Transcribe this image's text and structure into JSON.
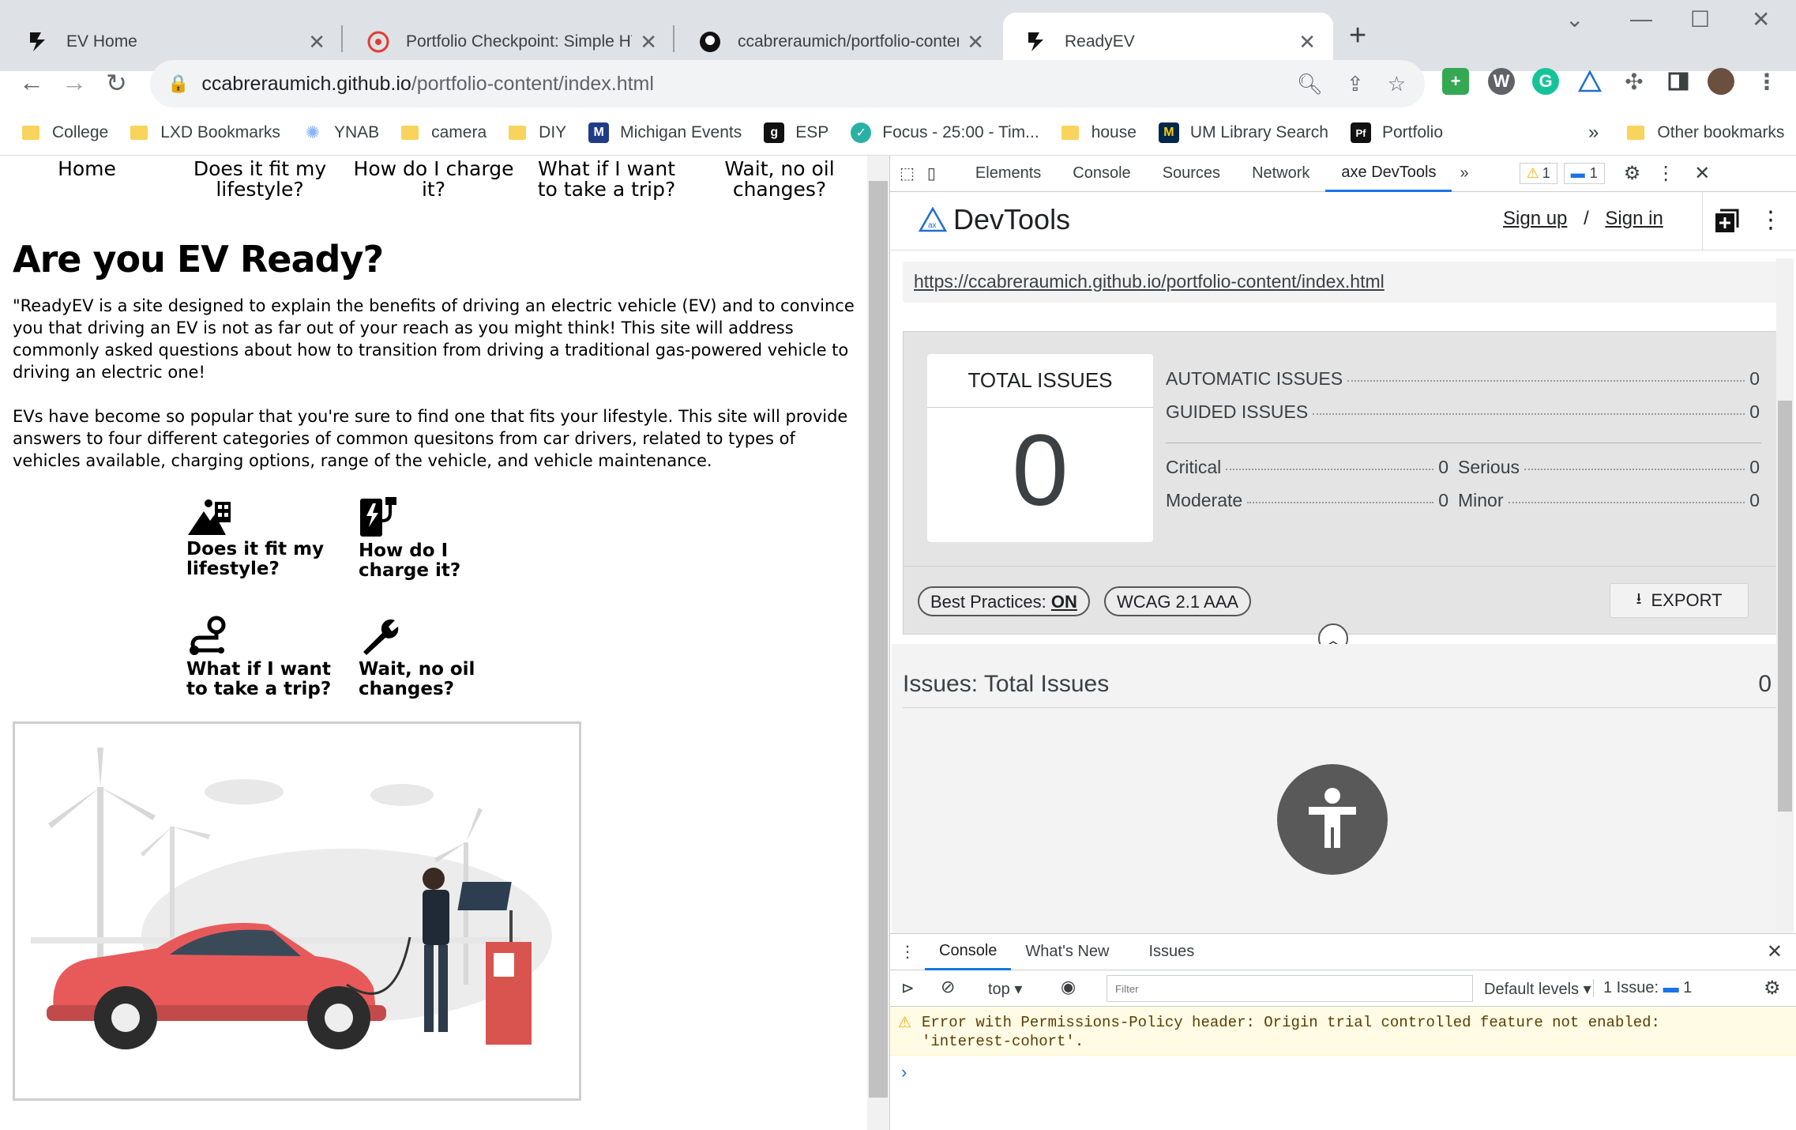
{
  "tabs": [
    {
      "title": "EV Home",
      "icon": "bolt-icon"
    },
    {
      "title": "Portfolio Checkpoint: Simple HTML",
      "icon": "canvas-icon"
    },
    {
      "title": "ccabreraumich/portfolio-content",
      "icon": "github-icon"
    },
    {
      "title": "ReadyEV",
      "icon": "bolt-icon",
      "active": true
    }
  ],
  "address": {
    "host": "ccabreraumich.github.io",
    "path": "/portfolio-content/index.html"
  },
  "bookmarks": [
    {
      "label": "College",
      "icon": "folder"
    },
    {
      "label": "LXD Bookmarks",
      "icon": "folder"
    },
    {
      "label": "YNAB",
      "icon": "ynab-icon"
    },
    {
      "label": "camera",
      "icon": "folder"
    },
    {
      "label": "DIY",
      "icon": "folder"
    },
    {
      "label": "Michigan Events",
      "icon": "events-icon"
    },
    {
      "label": "ESP",
      "icon": "esp-icon"
    },
    {
      "label": "Focus - 25:00 - Tim...",
      "icon": "check-icon"
    },
    {
      "label": "house",
      "icon": "folder"
    },
    {
      "label": "UM Library Search",
      "icon": "um-icon"
    },
    {
      "label": "Portfolio",
      "icon": "portfolio-icon"
    }
  ],
  "bookmarks_more": "»",
  "other_bookmarks": "Other bookmarks",
  "site": {
    "nav": [
      "Home",
      "Does it fit my lifestyle?",
      "How do I charge it?",
      "What if I want to take a trip?",
      "Wait, no oil changes?"
    ],
    "heading": "Are you EV Ready?",
    "p1": "\"ReadyEV is a site designed to explain the benefits of driving an electric vehicle (EV) and to convince you that driving an EV is not as far out of your reach as you might think! This site will address commonly asked questions about how to transition from driving a traditional gas-powered vehicle to driving an electric one!",
    "p2": "EVs have become so popular that you're sure to find one that fits your lifestyle. This site will provide answers to four different categories of common quesitons from car drivers, related to types of vehicles available, charging options, range of the vehicle, and vehicle maintenance.",
    "cards": [
      {
        "label": "Does it fit my lifestyle?",
        "icon": "lifestyle-icon"
      },
      {
        "label": "How do I charge it?",
        "icon": "charger-icon"
      },
      {
        "label": "What if I want to take a trip?",
        "icon": "route-icon"
      },
      {
        "label": "Wait, no oil changes?",
        "icon": "wrench-icon"
      }
    ]
  },
  "devtools": {
    "tabs": [
      "Elements",
      "Console",
      "Sources",
      "Network",
      "axe DevTools"
    ],
    "more": "»",
    "warn_count": "1",
    "info_count": "1",
    "axe": {
      "title": "DevTools",
      "signup": "Sign up",
      "sep": "/",
      "signin": "Sign in",
      "url": "https://ccabreraumich.github.io/portfolio-content/index.html",
      "total_label": "TOTAL ISSUES",
      "total": "0",
      "automatic_label": "AUTOMATIC ISSUES",
      "automatic": "0",
      "guided_label": "GUIDED ISSUES",
      "guided": "0",
      "critical_label": "Critical",
      "critical": "0",
      "serious_label": "Serious",
      "serious": "0",
      "moderate_label": "Moderate",
      "moderate": "0",
      "minor_label": "Minor",
      "minor": "0",
      "best_practices": "Best Practices:",
      "best_practices_state": "ON",
      "wcag": "WCAG 2.1 AAA",
      "export": "EXPORT",
      "issues_title": "Issues: Total Issues",
      "issues_count": "0"
    },
    "drawer": {
      "tabs": [
        "Console",
        "What's New",
        "Issues"
      ],
      "context": "top",
      "filter_placeholder": "Filter",
      "levels": "Default levels",
      "issues_label": "1 Issue:",
      "issues_count": "1",
      "warning_line1": "Error with Permissions-Policy header: Origin trial controlled feature not enabled:",
      "warning_line2": "'interest-cohort'.",
      "prompt": "›"
    }
  },
  "colors": {
    "accent": "#1a73e8",
    "tabstrip": "#dee1e6",
    "car": "#e85a5a"
  }
}
